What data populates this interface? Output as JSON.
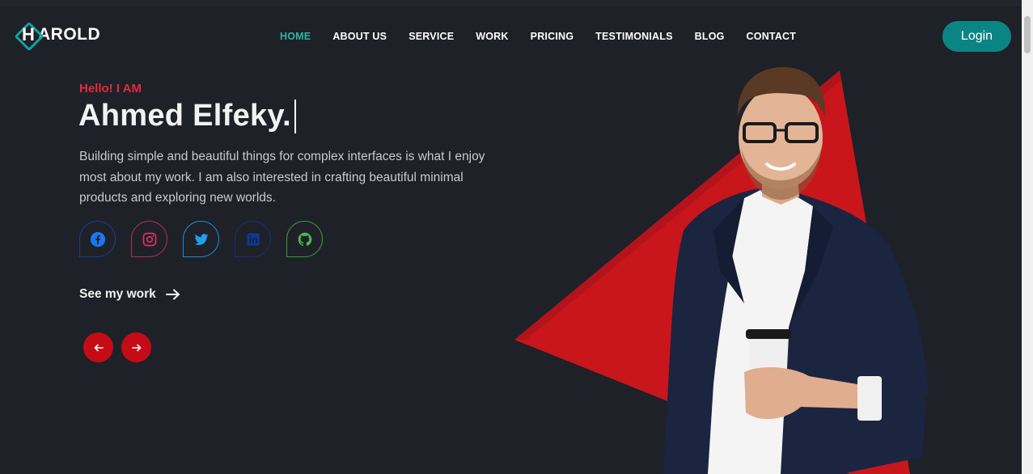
{
  "brand": {
    "logo_letter": "H",
    "logo_text": "AROLD"
  },
  "nav": {
    "items": [
      {
        "label": "HOME",
        "active": true
      },
      {
        "label": "ABOUT US",
        "active": false
      },
      {
        "label": "SERVICE",
        "active": false
      },
      {
        "label": "WORK",
        "active": false
      },
      {
        "label": "PRICING",
        "active": false
      },
      {
        "label": "TESTIMONIALS",
        "active": false
      },
      {
        "label": "BLOG",
        "active": false
      },
      {
        "label": "CONTACT",
        "active": false
      }
    ],
    "login_label": "Login"
  },
  "hero": {
    "greeting": "Hello! I AM",
    "name": "Ahmed Elfeky.",
    "bio": "Building simple and beautiful things for complex interfaces is what I enjoy most about my work. I am also interested in crafting beautiful minimal products and exploring new worlds.",
    "cta_label": "See my work"
  },
  "socials": [
    {
      "name": "facebook",
      "icon": "facebook-icon",
      "color": "#1877f2"
    },
    {
      "name": "instagram",
      "icon": "instagram-icon",
      "color": "#e1306c"
    },
    {
      "name": "twitter",
      "icon": "twitter-icon",
      "color": "#1da1f2"
    },
    {
      "name": "linkedin",
      "icon": "linkedin-icon",
      "color": "#0a3a9c"
    },
    {
      "name": "github",
      "icon": "github-icon",
      "color": "#4fb84f"
    }
  ],
  "colors": {
    "background": "#1f2128",
    "accent_teal": "#0b8584",
    "accent_red": "#c40c16",
    "greeting_red": "#e32b3c"
  }
}
